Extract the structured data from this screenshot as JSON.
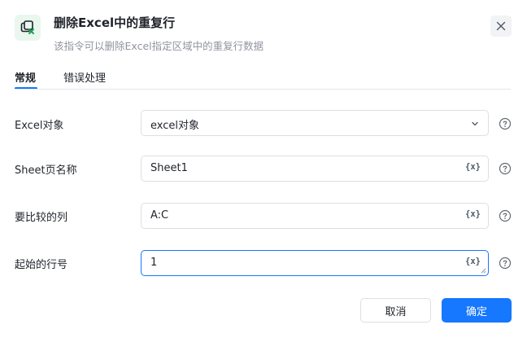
{
  "header": {
    "title": "删除Excel中的重复行",
    "description": "该指令可以删除Excel指定区域中的重复行数据",
    "icon": "delete-duplicates-icon",
    "accent": "#1aa251"
  },
  "tabs": [
    {
      "label": "常规",
      "active": true
    },
    {
      "label": "错误处理",
      "active": false
    }
  ],
  "form": {
    "excel_object": {
      "label": "Excel对象",
      "value": "excel对象"
    },
    "sheet_name": {
      "label": "Sheet页名称",
      "value": "Sheet1",
      "suffix": "{x}"
    },
    "compare_columns": {
      "label": "要比较的列",
      "value": "A:C",
      "suffix": "{x}"
    },
    "start_row": {
      "label": "起始的行号",
      "value": "1",
      "suffix": "{x}"
    }
  },
  "footer": {
    "cancel_label": "取消",
    "confirm_label": "确定"
  },
  "colors": {
    "primary": "#1677ff",
    "border": "#dcdfe6"
  }
}
